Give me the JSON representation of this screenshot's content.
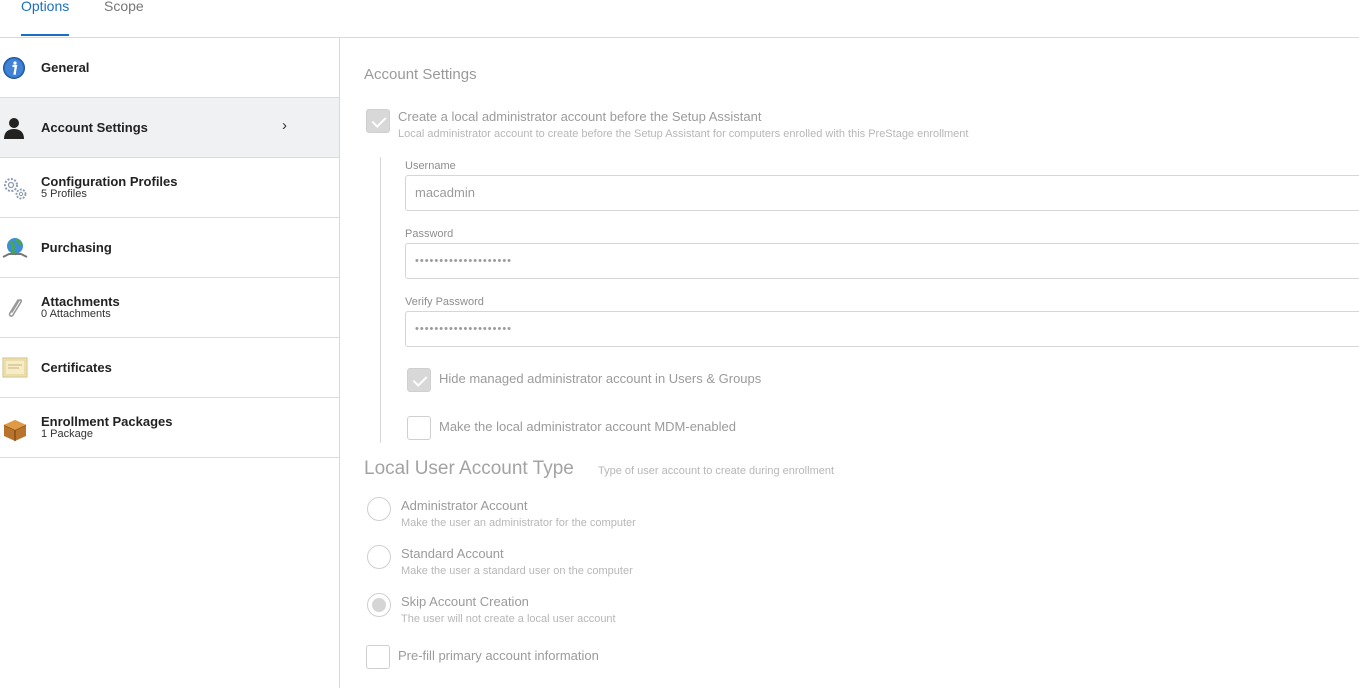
{
  "tabs": [
    {
      "label": "Options"
    },
    {
      "label": "Scope"
    }
  ],
  "sidebar": {
    "items": [
      {
        "title": "General",
        "subtitle": "",
        "icon": "info-icon"
      },
      {
        "title": "Account Settings",
        "subtitle": "",
        "icon": "user-icon"
      },
      {
        "title": "Configuration Profiles",
        "subtitle": "5 Profiles",
        "icon": "gears-icon"
      },
      {
        "title": "Purchasing",
        "subtitle": "",
        "icon": "globe-icon"
      },
      {
        "title": "Attachments",
        "subtitle": "0 Attachments",
        "icon": "paperclip-icon"
      },
      {
        "title": "Certificates",
        "subtitle": "",
        "icon": "certificate-icon"
      },
      {
        "title": "Enrollment Packages",
        "subtitle": "1 Package",
        "icon": "package-icon"
      }
    ],
    "active_chevron": "›"
  },
  "main": {
    "title": "Account Settings",
    "create_admin": {
      "label": "Create a local administrator account before the Setup Assistant",
      "description": "Local administrator account to create before the Setup Assistant for computers enrolled with this PreStage enrollment",
      "checked": true
    },
    "username": {
      "label": "Username",
      "value": "macadmin"
    },
    "password": {
      "label": "Password",
      "value": "••••••••••••••••••••"
    },
    "verify_password": {
      "label": "Verify Password",
      "value": "••••••••••••••••••••"
    },
    "hide_admin": {
      "label": "Hide managed administrator account in Users & Groups",
      "checked": true
    },
    "mdm_enabled": {
      "label": "Make the local administrator account MDM-enabled",
      "checked": false
    },
    "local_user": {
      "title": "Local User Account Type",
      "description": "Type of user account to create during enrollment",
      "options": [
        {
          "label": "Administrator Account",
          "description": "Make the user an administrator for the computer",
          "selected": false
        },
        {
          "label": "Standard Account",
          "description": "Make the user a standard user on the computer",
          "selected": false
        },
        {
          "label": "Skip Account Creation",
          "description": "The user will not create a local user account",
          "selected": true
        }
      ]
    },
    "prefill": {
      "label": "Pre-fill primary account information",
      "checked": false
    }
  },
  "colors": {
    "accent": "#1b6fc2",
    "muted_text": "#9b9b9b",
    "border": "#d6d6d6",
    "active_row": "#f0f1f3"
  }
}
